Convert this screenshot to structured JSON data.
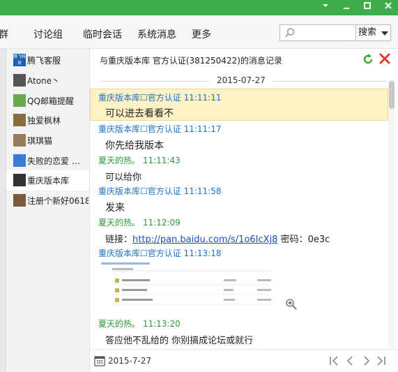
{
  "toolbar": {
    "tabs": [
      "群",
      "讨论组",
      "临时会话",
      "系统消息",
      "更多"
    ],
    "search_placeholder": "",
    "search_button": "搜索"
  },
  "contacts": [
    {
      "name": "腾飞客服",
      "avatar_color": "#1a5fb4",
      "avatar_text": "腾飞科技"
    },
    {
      "name": "Atone丶",
      "avatar_color": "#555555",
      "avatar_text": ""
    },
    {
      "name": "QQ邮箱提醒",
      "avatar_color": "#6aa84f",
      "avatar_text": ""
    },
    {
      "name": "独爱枫林",
      "avatar_color": "#8a6d3b",
      "avatar_text": ""
    },
    {
      "name": "琪琪猫",
      "avatar_color": "#9a7a5a",
      "avatar_text": ""
    },
    {
      "name": "失败的恋爱 …",
      "avatar_color": "#3a7bd5",
      "avatar_text": ""
    },
    {
      "name": "重庆版本库",
      "avatar_color": "#333333",
      "avatar_text": ""
    },
    {
      "name": "注册个新好0618",
      "avatar_color": "#7a5a3a",
      "avatar_text": ""
    }
  ],
  "main": {
    "title": "与重庆版本库  官方认证(381250422)的消息记录",
    "date_separator": "2015-07-27"
  },
  "messages": [
    {
      "sender": "重庆版本库☐官方认证",
      "time": "11:11:11",
      "text": "可以进去看看不"
    },
    {
      "sender": "重庆版本库☐官方认证",
      "time": "11:11:17",
      "text": "你先给我版本"
    },
    {
      "sender": "夏天的热。",
      "time": "11:11:43",
      "text": "可以给你"
    },
    {
      "sender": "重庆版本库☐官方认证",
      "time": "11:11:58",
      "text": "发来"
    },
    {
      "sender": "夏天的热。",
      "time": "11:12:09",
      "link_prefix": "链接：",
      "link": "http://pan.baidu.com/s/1o6IcXj8",
      "link_suffix": " 密码：0e3c"
    },
    {
      "sender": "重庆版本库☐官方认证",
      "time": "11:13:18"
    },
    {
      "sender": "夏天的热。",
      "time": "11:13:20",
      "text": "答应他不乱给的 你别搞成论坛或就行"
    }
  ],
  "footer": {
    "date": "2015-7-27"
  },
  "colors": {
    "titlebar": "#3dae49",
    "sender_blue": "#1a73c7",
    "sender_green": "#2a9a3a",
    "highlight": "#fdf1c6"
  }
}
